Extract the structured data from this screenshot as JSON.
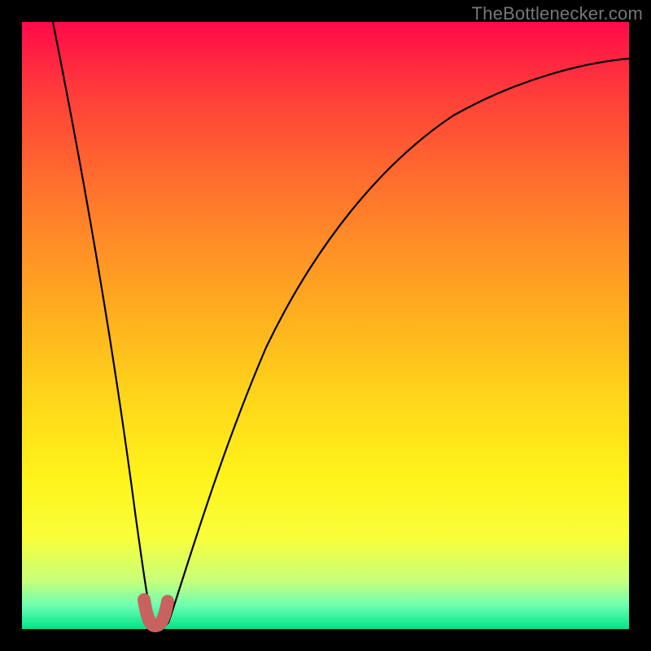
{
  "watermark": "TheBottlenecker.com",
  "chart_data": {
    "type": "line",
    "title": "",
    "xlabel": "",
    "ylabel": "",
    "xlim": [
      0,
      100
    ],
    "ylim": [
      0,
      100
    ],
    "x": [
      0,
      5,
      10,
      15,
      18,
      20,
      21,
      22,
      23,
      25,
      28,
      32,
      38,
      45,
      55,
      65,
      75,
      85,
      95,
      100
    ],
    "values": [
      100,
      78,
      55,
      30,
      12,
      3,
      0,
      0,
      3,
      12,
      26,
      41,
      56,
      67,
      77,
      83,
      88,
      91,
      93,
      94
    ],
    "minimum_x": 21,
    "annotations": [
      {
        "type": "marker",
        "shape": "U",
        "x_range": [
          19.5,
          23
        ],
        "note": "red/pink U-shaped marker at curve minimum"
      }
    ],
    "background": "vertical gradient red→orange→yellow→green",
    "frame": "black border ~27px"
  }
}
